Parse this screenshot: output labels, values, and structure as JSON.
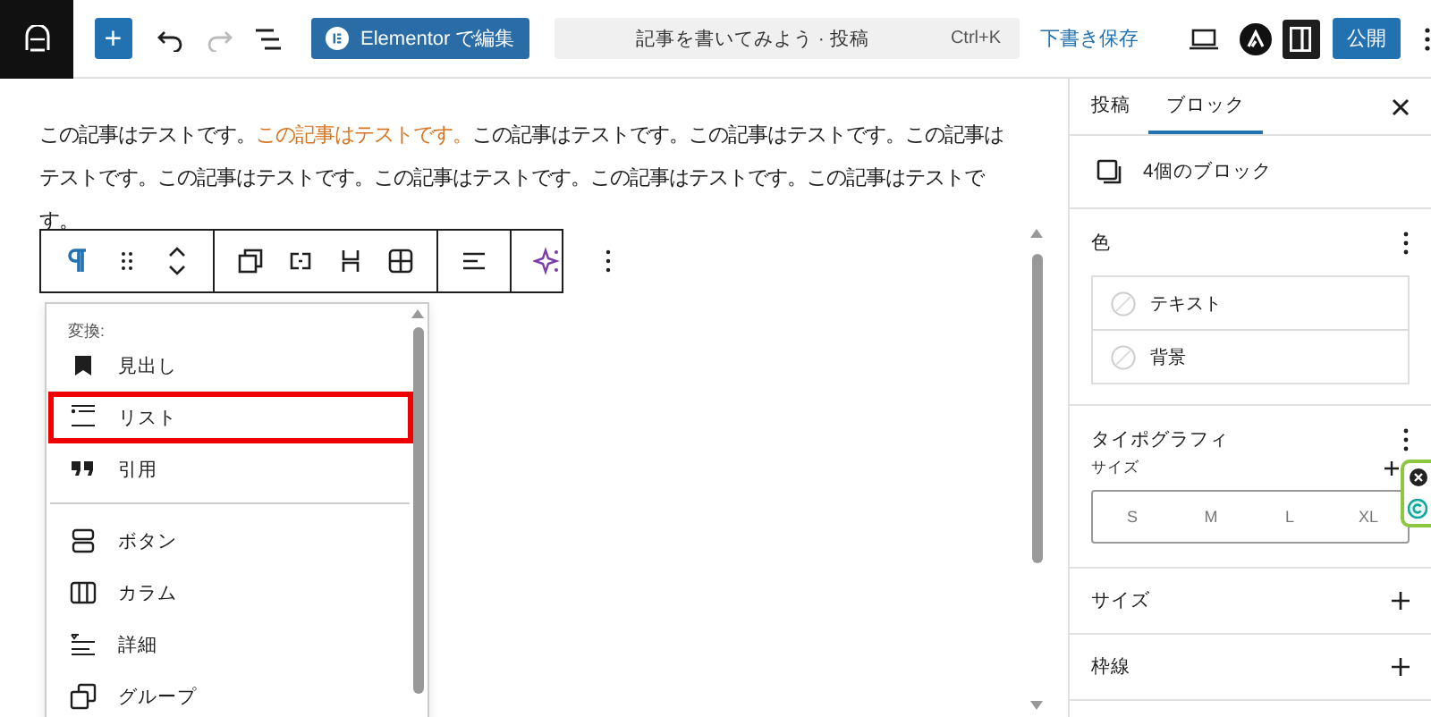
{
  "topbar": {
    "add_button": "+",
    "elementor_button": "Elementor で編集",
    "command": {
      "title": "記事を書いてみよう · 投稿",
      "shortcut": "Ctrl+K"
    },
    "save_draft": "下書き保存",
    "settings_pressed": true,
    "publish": "公開"
  },
  "content": {
    "paragraph": [
      {
        "text": "この記事はテストです。",
        "highlight": false
      },
      {
        "text": "この記事はテストです。",
        "highlight": true
      },
      {
        "text": "この記事はテストです。この記事はテストです。この記事はテストです。この記事はテストです。この記事はテストです。この記事はテストです。この記事はテストです。",
        "highlight": false
      }
    ]
  },
  "transform_menu": {
    "heading": "変換:",
    "groups": [
      [
        {
          "label": "見出し",
          "kind": "heading",
          "highlighted": false
        },
        {
          "label": "リスト",
          "kind": "list",
          "highlighted": true
        },
        {
          "label": "引用",
          "kind": "quote",
          "highlighted": false
        }
      ],
      [
        {
          "label": "ボタン",
          "kind": "buttons",
          "highlighted": false
        },
        {
          "label": "カラム",
          "kind": "columns",
          "highlighted": false
        },
        {
          "label": "詳細",
          "kind": "details",
          "highlighted": false
        },
        {
          "label": "グループ",
          "kind": "group",
          "highlighted": false
        }
      ]
    ]
  },
  "sidebar": {
    "tabs": [
      {
        "label": "投稿",
        "selected": false
      },
      {
        "label": "ブロック",
        "selected": true
      }
    ],
    "block_info": "4個のブロック",
    "panels": [
      {
        "kind": "color",
        "title": "色",
        "options": [
          "テキスト",
          "背景"
        ]
      },
      {
        "kind": "typography",
        "title": "タイポグラフィ",
        "size_label": "サイズ",
        "sizes": [
          "S",
          "M",
          "L",
          "XL"
        ]
      },
      {
        "kind": "collapsed",
        "title": "サイズ"
      },
      {
        "kind": "collapsed",
        "title": "枠線"
      }
    ]
  }
}
